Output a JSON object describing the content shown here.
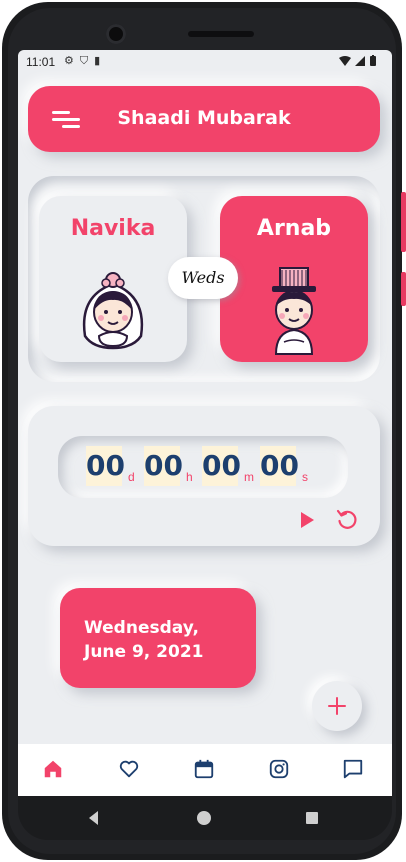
{
  "status_bar": {
    "time": "11:01",
    "left_icons": [
      "gear-icon",
      "shield-icon",
      "sd-card-icon"
    ],
    "right_icons": [
      "wifi-icon",
      "signal-icon",
      "battery-icon"
    ]
  },
  "app_bar": {
    "title": "Shaadi Mubarak",
    "menu_icon": "hamburger-menu-icon"
  },
  "couple": {
    "bride_name": "Navika",
    "groom_name": "Arnab",
    "weds_label": "Weds"
  },
  "timer": {
    "days": "00",
    "days_unit": "d",
    "hours": "00",
    "hours_unit": "h",
    "minutes": "00",
    "minutes_unit": "m",
    "seconds": "00",
    "seconds_unit": "s"
  },
  "date_card": {
    "line1": "Wednesday,",
    "line2": "June 9, 2021"
  },
  "fab": {
    "icon": "plus-icon"
  },
  "bottom_nav": [
    "home-icon",
    "heart-icon",
    "calendar-icon",
    "instagram-icon",
    "chat-icon"
  ],
  "colors": {
    "accent": "#f2436a",
    "background": "#eceef1",
    "digit_text": "#1d3f6e",
    "digit_bg": "#fdf3d9"
  }
}
